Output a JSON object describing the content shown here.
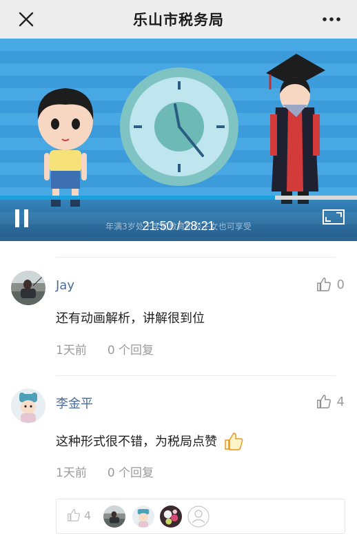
{
  "header": {
    "title": "乐山市税务局"
  },
  "video": {
    "subtitle": "年满3岁处于学前教育阶段子女也可享受",
    "current_time": "21:50",
    "separator": "/",
    "duration": "28:21",
    "progress_fraction": 0.77,
    "playing": true
  },
  "comments": [
    {
      "username": "Jay",
      "likes": "0",
      "text": "还有动画解析，讲解很到位",
      "time": "1天前",
      "replies": "0 个回复",
      "avatar_icon": "photo-avatar-fisherman"
    },
    {
      "username": "李金平",
      "likes": "4",
      "text": "这种形式很不错，为税局点赞",
      "emoji": "thumbs-up-emoji",
      "time": "1天前",
      "replies": "0 个回复",
      "avatar_icon": "cartoon-avatar-hat"
    }
  ],
  "likers": {
    "count": "4",
    "avatars": [
      "photo-avatar-fisherman",
      "cartoon-avatar-hat",
      "photo-avatar-flowers",
      "default-user-avatar"
    ]
  },
  "colors": {
    "topbar_bg": "#ededed",
    "username": "#4b6a95",
    "progress": "#1aa0dd",
    "video_bg": "#48a8e4"
  }
}
